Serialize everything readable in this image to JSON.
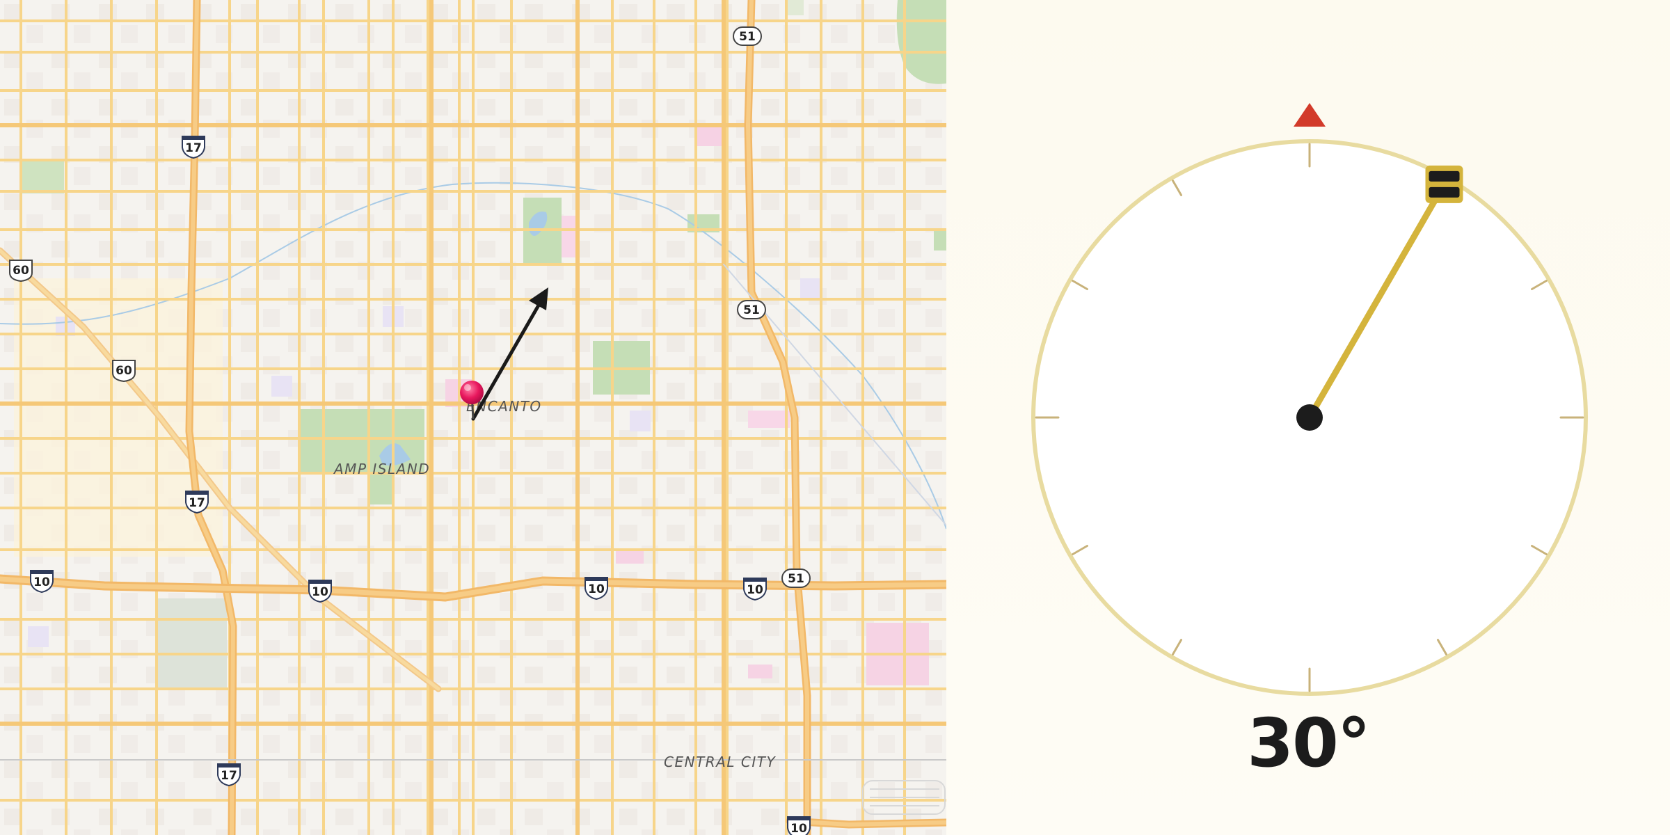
{
  "map": {
    "places": [
      {
        "id": "encanto",
        "label": "ENCANTO"
      },
      {
        "id": "amp-island",
        "label": "AMP ISLAND"
      },
      {
        "id": "central-city",
        "label": "CENTRAL CITY"
      }
    ],
    "route_shields": [
      {
        "type": "us",
        "number": "60"
      },
      {
        "type": "us",
        "number": "60"
      },
      {
        "type": "interstate",
        "number": "17"
      },
      {
        "type": "interstate",
        "number": "17"
      },
      {
        "type": "interstate",
        "number": "17"
      },
      {
        "type": "state",
        "number": "51"
      },
      {
        "type": "state",
        "number": "51"
      },
      {
        "type": "state",
        "number": "51"
      },
      {
        "type": "interstate",
        "number": "10"
      },
      {
        "type": "interstate",
        "number": "10"
      },
      {
        "type": "interstate",
        "number": "10"
      },
      {
        "type": "interstate",
        "number": "10"
      },
      {
        "type": "interstate",
        "number": "10"
      }
    ],
    "marker": {
      "icon": "map-pin-icon",
      "color": "#e8175d"
    },
    "heading_arrow": {
      "icon": "heading-arrow-icon",
      "color": "#1a1a1a"
    }
  },
  "compass": {
    "heading_deg": 30,
    "heading_label": "30°",
    "north_marker_color": "#d23a2a",
    "needle_color": "#d4b43c",
    "ring_color": "#e8dba0",
    "tick_color": "#c8b27a"
  },
  "colors": {
    "road": "#f7d58a",
    "highway": "#f6c27a",
    "park": "#b9d9a8",
    "water": "#a9cbe6"
  }
}
